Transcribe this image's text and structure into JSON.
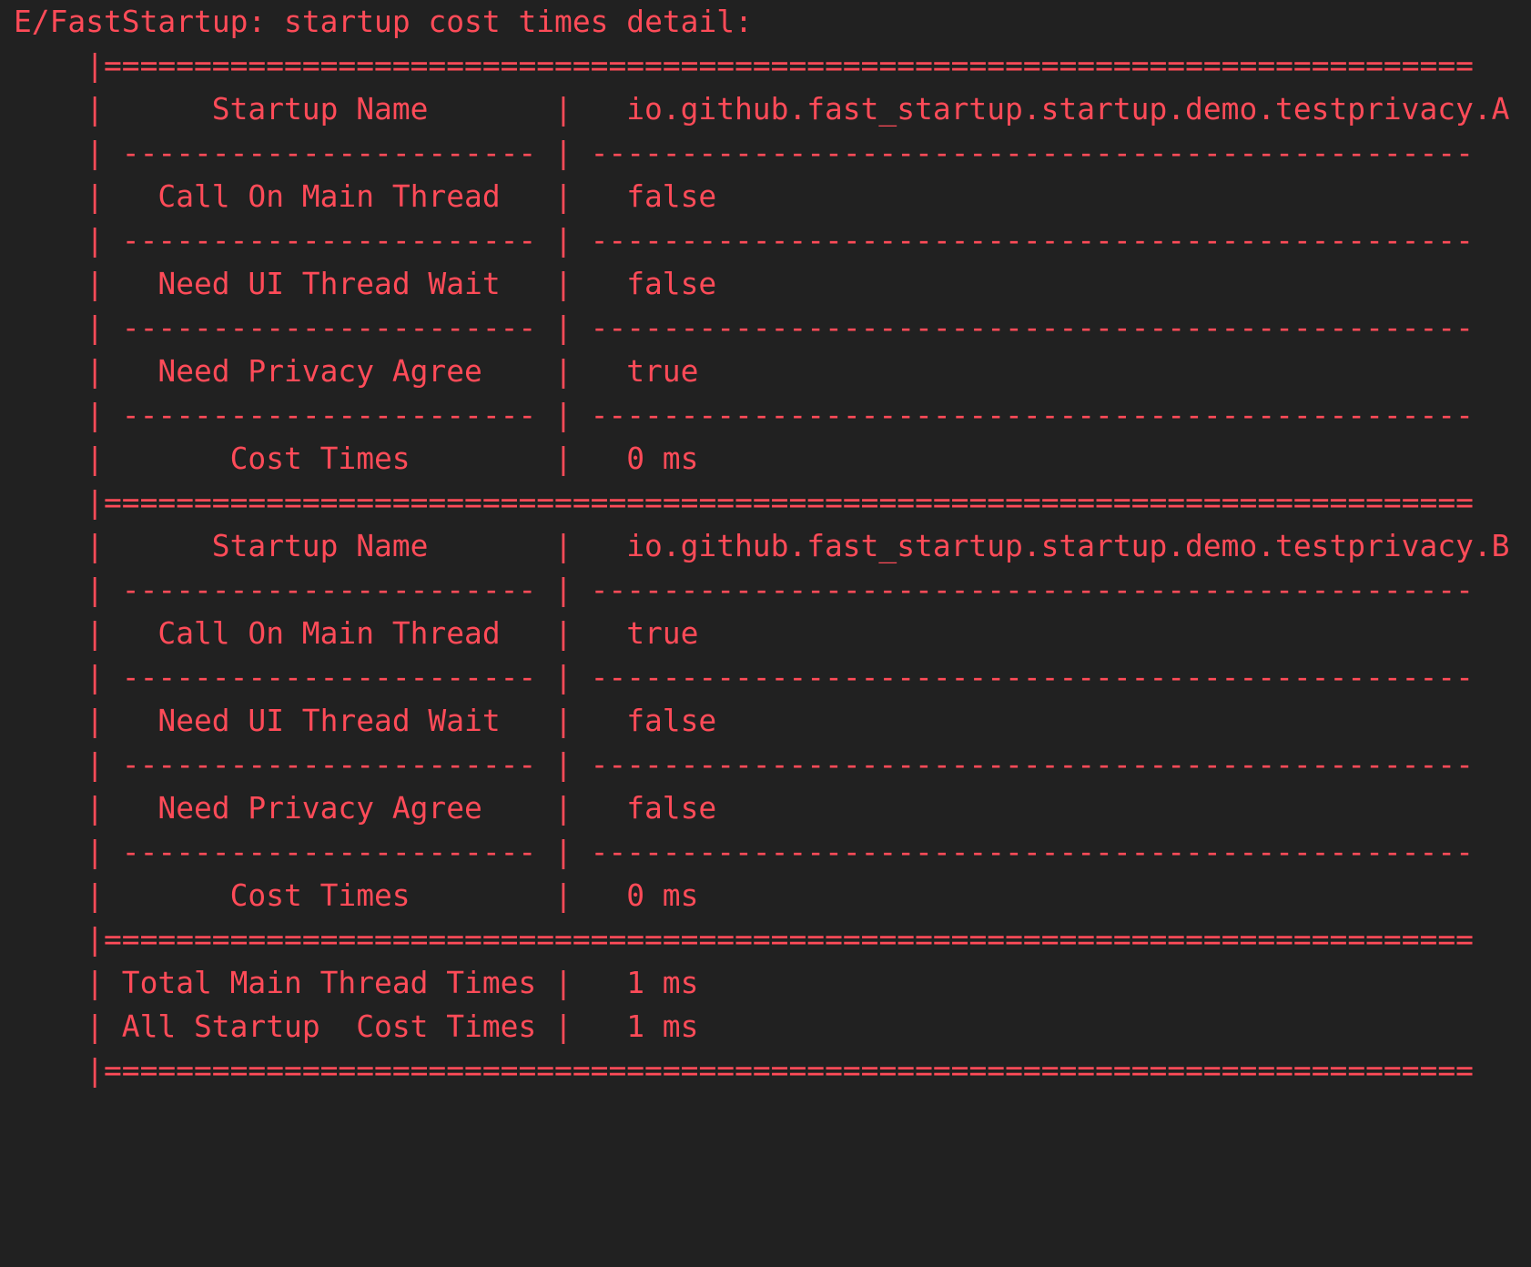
{
  "log": {
    "header": "E/FastStartup: startup cost times detail:",
    "border": {
      "pipe": "|",
      "double_rule": "============================================================================",
      "label_rule": "-----------------------",
      "value_rule": "-------------------------------------------------"
    },
    "labels": {
      "startup_name": "Startup Name",
      "call_on_main_thread": "Call On Main Thread",
      "need_ui_thread_wait": "Need UI Thread Wait",
      "need_privacy_agree": "Need Privacy Agree",
      "cost_times": "Cost Times",
      "total_main_thread_times": "Total Main Thread Times",
      "all_startup_cost_times": "All Startup  Cost Times"
    },
    "startups": [
      {
        "startup_name": "io.github.fast_startup.startup.demo.testprivacy.A",
        "call_on_main_thread": "false",
        "need_ui_thread_wait": "false",
        "need_privacy_agree": "true",
        "cost_times": "0 ms"
      },
      {
        "startup_name": "io.github.fast_startup.startup.demo.testprivacy.B",
        "call_on_main_thread": "true",
        "need_ui_thread_wait": "false",
        "need_privacy_agree": "false",
        "cost_times": "0 ms"
      }
    ],
    "summary": {
      "total_main_thread_times": "1 ms",
      "all_startup_cost_times": "1 ms"
    }
  },
  "colors": {
    "background": "#212121",
    "log_error_text": "#ff4b58"
  }
}
